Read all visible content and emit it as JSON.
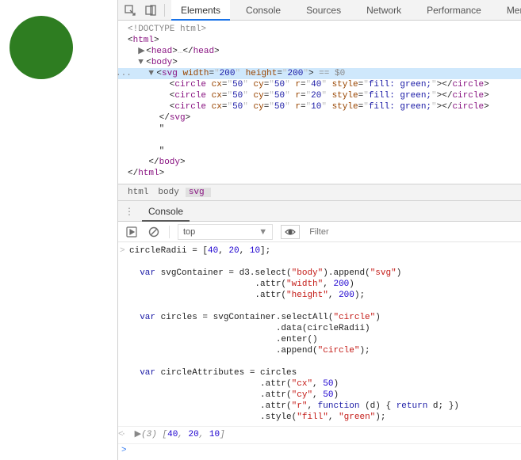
{
  "toolbar": {
    "tabs": [
      "Elements",
      "Console",
      "Sources",
      "Network",
      "Performance",
      "Memory"
    ]
  },
  "elements": {
    "doctype": "<!DOCTYPE html>",
    "htmlOpen": "html",
    "headOpen": "head",
    "headEllipsis": "…",
    "headClose": "head",
    "bodyOpen": "body",
    "svgOpen": "svg",
    "svgWidthAttr": "width",
    "svgWidthVal": "200",
    "svgHeightAttr": "height",
    "svgHeightVal": "200",
    "eqSel": " == $0",
    "circle": "circle",
    "cx": "cx",
    "cxv": "50",
    "cy": "cy",
    "cyv": "50",
    "r": "r",
    "r1": "40",
    "r2": "20",
    "r3": "10",
    "styleAttr": "style",
    "styleVal": "fill: green;",
    "svgClose": "svg",
    "quote": "\"",
    "bodyClose": "body",
    "htmlClose": "html"
  },
  "breadcrumb": {
    "items": [
      "html",
      "body",
      "svg"
    ]
  },
  "console": {
    "title": "Console",
    "context": "top",
    "filterPlaceholder": "Filter",
    "line1_pre": "circleRadii = [",
    "v40": "40",
    "v20": "20",
    "v10": "10",
    "l1_close": "];",
    "l2a": "var",
    "l2b": " svgContainer = d3.select(",
    "l2c": "\"body\"",
    "l2d": ").append(",
    "l2e": "\"svg\"",
    "l2f": ")",
    "l3a": "                      .attr(",
    "l3b": "\"width\"",
    "l3c": ", ",
    "l3d": "200",
    "l3e": ")",
    "l4a": "                      .attr(",
    "l4b": "\"height\"",
    "l4c": ", ",
    "l4d": "200",
    "l4e": ");",
    "l5a": "var",
    "l5b": " circles = svgContainer.selectAll(",
    "l5c": "\"circle\"",
    "l5d": ")",
    "l6": "                          .data(circleRadii)",
    "l7": "                          .enter()",
    "l8a": "                          .append(",
    "l8b": "\"circle\"",
    "l8c": ");",
    "l9a": "var",
    "l9b": " circleAttributes = circles",
    "l10a": "                       .attr(",
    "l10b": "\"cx\"",
    "l10c": ", ",
    "l10d": "50",
    "l10e": ")",
    "l11a": "                       .attr(",
    "l11b": "\"cy\"",
    "l11c": ", ",
    "l11d": "50",
    "l11e": ")",
    "l12a": "                       .attr(",
    "l12b": "\"r\"",
    "l12c": ", ",
    "l12d": "function",
    "l12e": " (d) { ",
    "l12f": "return",
    "l12g": " d; })",
    "l13a": "                       .style(",
    "l13b": "\"fill\"",
    "l13c": ", ",
    "l13d": "\"green\"",
    "l13e": ");",
    "resPre": "(3) [",
    "resSuf": "]",
    "res40": "40",
    "res20": "20",
    "res10": "10"
  }
}
